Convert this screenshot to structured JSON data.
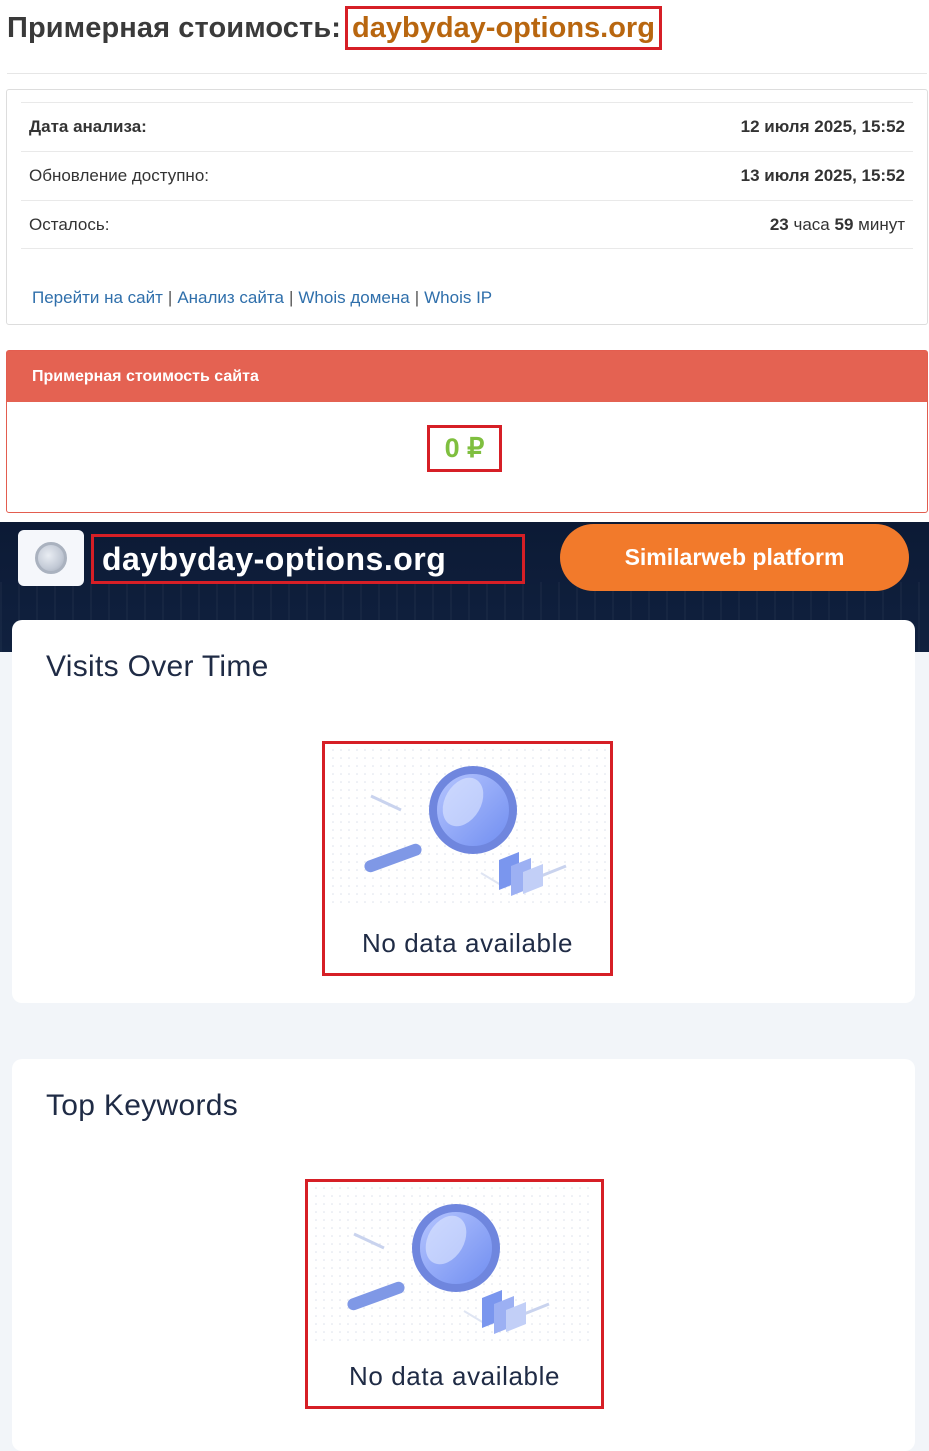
{
  "header": {
    "title": "Примерная стоимость:",
    "domain": "daybyday-options.org"
  },
  "info": {
    "rows": [
      {
        "label": "Дата анализа:",
        "value": "12 июля 2025, 15:52"
      },
      {
        "label": "Обновление доступно:",
        "value": "13 июля 2025, 15:52"
      },
      {
        "label": "Осталось:",
        "hours": "23",
        "hours_unit": "часа",
        "minutes": "59",
        "minutes_unit": "минут"
      }
    ],
    "links": [
      "Перейти на сайт",
      "Анализ сайта",
      "Whois домена",
      "Whois IP"
    ],
    "link_separator": "|"
  },
  "cost": {
    "heading": "Примерная стоимость сайта",
    "value": "0 ₽"
  },
  "similarweb": {
    "domain": "daybyday-options.org",
    "platform_button": "Similarweb platform",
    "cards": [
      {
        "title": "Visits Over Time",
        "empty_text": "No data available"
      },
      {
        "title": "Top Keywords",
        "empty_text": "No data available"
      }
    ]
  },
  "colors": {
    "domain_accent": "#b8660f",
    "highlight_border": "#d61f26",
    "cost_header": "#e46252",
    "cost_value": "#7fbf3f",
    "link": "#2f6fab",
    "sw_header_bg": "#0c1a35",
    "sw_button": "#f27a2b"
  }
}
